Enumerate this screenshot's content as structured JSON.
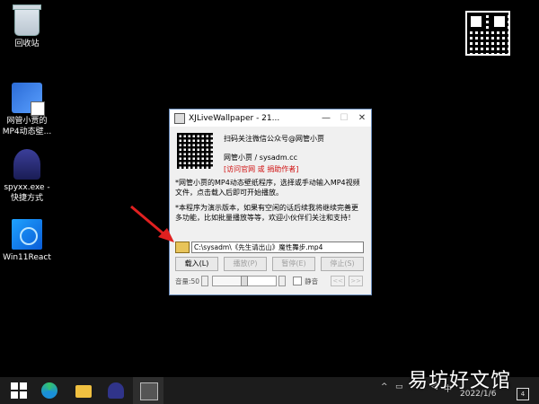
{
  "desktop": {
    "icons": [
      {
        "label": "回收站"
      },
      {
        "label": "网管小贾的\nMP4动态壁..."
      },
      {
        "label": "spyxx.exe -\n快捷方式"
      },
      {
        "label": "Win11React"
      }
    ]
  },
  "window": {
    "title": "XJLiveWallpaper - 21...",
    "minimize": "—",
    "maximize": "☐",
    "close": "✕",
    "scan_text": "扫码关注微信公众号@网管小贾",
    "site_text": "网管小贾 / sysadm.cc",
    "links_text": "[访问官网 或 捐助作者]",
    "desc1": "*网管小贾的MP4动态壁纸程序，选择或手动输入MP4视频文件，点击载入后即可开始播放。",
    "desc2": "*本程序为演示版本，如果有空闲的话后续我将继续完善更多功能，比如批量播放等等，欢迎小伙伴们关注和支持！",
    "file_path": "C:\\sysadm\\《先生请出山》魔性舞步.mp4",
    "buttons": {
      "load": "载入(L)",
      "play": "播放(P)",
      "pause": "暂停(E)",
      "stop": "停止(S)"
    },
    "volume_label": "音量:50",
    "volume": 50,
    "mute_label": "静音",
    "prev": "<<",
    "next": ">>"
  },
  "taskbar": {
    "ime": "中",
    "clock_time": "1:...",
    "clock_date": "2022/1/6",
    "notif_count": "4"
  },
  "watermark": "易坊好文馆",
  "colors": {
    "accent_red": "#d01010",
    "desktop_bg": "#000000",
    "taskbar_bg": "#1c1c1c"
  }
}
